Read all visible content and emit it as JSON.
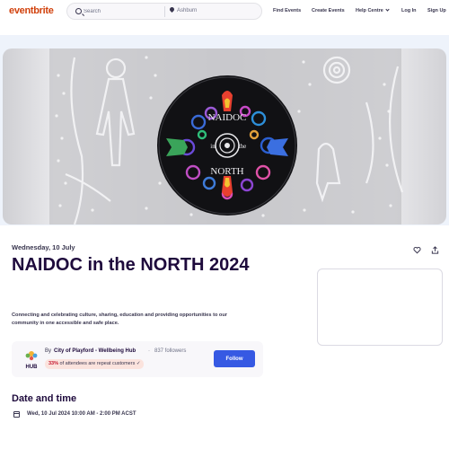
{
  "header": {
    "logo": "eventbrite",
    "search": {
      "placeholder": "Search",
      "location": "Ashburn"
    },
    "nav": [
      {
        "label": "Find Events"
      },
      {
        "label": "Create Events"
      },
      {
        "label": "Help Centre"
      },
      {
        "label": "Log In"
      },
      {
        "label": "Sign Up"
      }
    ]
  },
  "event": {
    "date_label": "Wednesday, 10 July",
    "title": "NAIDOC in the NORTH 2024",
    "description": "Connecting and celebrating culture, sharing, education and providing opportunities to our community in one accessible and safe place.",
    "hero_logo_text": [
      "NAIDOC",
      "in",
      "the",
      "NORTH"
    ]
  },
  "organizer": {
    "by_label": "By",
    "name": "City of Playford - Wellbeing Hub",
    "separator": "·",
    "followers": "837 followers",
    "repeat_percent": "33%",
    "repeat_text": "of attendees are repeat customers",
    "follow_label": "Follow",
    "avatar_text": "HUB"
  },
  "date_time": {
    "heading": "Date and time",
    "value": "Wed, 10 Jul 2024 10:00 AM - 2:00 PM ACST"
  },
  "icons": {
    "search": "search-icon",
    "location": "pin-icon",
    "like": "heart-icon",
    "share": "share-icon",
    "calendar": "calendar-icon"
  },
  "colors": {
    "brand": "#d1410c",
    "title": "#1e0a3c",
    "follow_button": "#3659e3",
    "badge_bg": "#fbe3dd",
    "badge_accent": "#c5162e"
  }
}
